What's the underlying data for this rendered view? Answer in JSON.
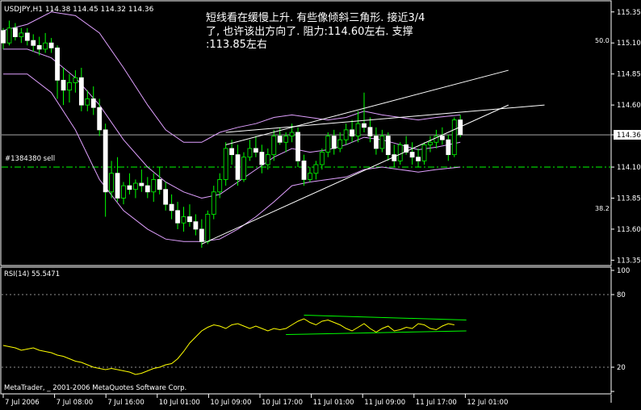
{
  "window": {
    "header": "USDJPY,H1  114.38 114.45 114.32 114.36",
    "annotation_lines": [
      "短线看在缓慢上升. 有些像倾斜三角形. 接近3/4",
      "了, 也许该出方向了. 阻力:114.60左右. 支撑",
      ":113.85左右"
    ],
    "order_label": "#1384380 sell",
    "rsi_label": "RSI(14) 55.5471",
    "copyright": "MetaTrader, _ 2001-2006 MetaQuotes Software Corp.",
    "current_price_tag": "114.36"
  },
  "colors": {
    "background": "#000000",
    "candle_up_body": "#000000",
    "candle_down_body": "#ffffff",
    "candle_wick": "#00ff00",
    "bollinger": "#e0a0ff",
    "trendline": "#ffffff",
    "order_line": "#00ff00",
    "rsi_line": "#ffff00",
    "rsi_trendline": "#00ff00",
    "axis_text": "#ffffff"
  },
  "chart_data": [
    {
      "type": "candlestick",
      "title": "USDJPY,H1",
      "y_ticks": [
        "115.35",
        "115.10",
        "114.85",
        "114.60",
        "114.36",
        "114.10",
        "113.85",
        "113.60",
        "113.35"
      ],
      "y_tick_values": [
        115.35,
        115.1,
        114.85,
        114.6,
        114.36,
        114.1,
        113.85,
        113.6,
        113.35
      ],
      "ylim": [
        113.32,
        115.42
      ],
      "side_labels": [
        {
          "text": "50.0",
          "value": 115.12
        },
        {
          "text": "38.2",
          "value": 113.77
        }
      ],
      "last_price": 114.36,
      "order_line_price": 114.1,
      "ohlc": [
        [
          115.2,
          115.22,
          115.05,
          115.1
        ],
        [
          115.1,
          115.28,
          115.08,
          115.22
        ],
        [
          115.22,
          115.26,
          115.12,
          115.15
        ],
        [
          115.15,
          115.22,
          115.1,
          115.18
        ],
        [
          115.18,
          115.22,
          115.08,
          115.12
        ],
        [
          115.12,
          115.17,
          115.03,
          115.08
        ],
        [
          115.08,
          115.15,
          115.0,
          115.05
        ],
        [
          115.05,
          115.18,
          115.02,
          115.1
        ],
        [
          115.1,
          115.14,
          115.02,
          115.06
        ],
        [
          115.06,
          115.08,
          114.65,
          114.8
        ],
        [
          114.8,
          114.9,
          114.6,
          114.72
        ],
        [
          114.72,
          114.85,
          114.62,
          114.78
        ],
        [
          114.78,
          114.88,
          114.7,
          114.82
        ],
        [
          114.82,
          114.9,
          114.55,
          114.6
        ],
        [
          114.6,
          114.72,
          114.55,
          114.65
        ],
        [
          114.65,
          114.75,
          114.52,
          114.58
        ],
        [
          114.58,
          114.65,
          114.35,
          114.4
        ],
        [
          114.4,
          114.45,
          113.7,
          113.9
        ],
        [
          113.9,
          114.15,
          113.85,
          114.05
        ],
        [
          114.05,
          114.18,
          113.82,
          113.85
        ],
        [
          113.85,
          113.98,
          113.8,
          113.95
        ],
        [
          113.95,
          114.05,
          113.88,
          113.92
        ],
        [
          113.92,
          114.0,
          113.85,
          113.97
        ],
        [
          113.97,
          114.08,
          113.9,
          113.95
        ],
        [
          113.95,
          114.02,
          113.85,
          113.9
        ],
        [
          113.9,
          114.05,
          113.82,
          114.0
        ],
        [
          114.0,
          114.1,
          113.88,
          113.92
        ],
        [
          113.92,
          113.98,
          113.75,
          113.8
        ],
        [
          113.8,
          113.88,
          113.68,
          113.75
        ],
        [
          113.75,
          113.82,
          113.6,
          113.65
        ],
        [
          113.65,
          113.78,
          113.58,
          113.7
        ],
        [
          113.7,
          113.8,
          113.62,
          113.66
        ],
        [
          113.66,
          113.72,
          113.55,
          113.6
        ],
        [
          113.6,
          113.68,
          113.45,
          113.5
        ],
        [
          113.5,
          113.75,
          113.48,
          113.72
        ],
        [
          113.72,
          113.95,
          113.68,
          113.9
        ],
        [
          113.9,
          114.05,
          113.85,
          114.0
        ],
        [
          114.0,
          114.3,
          113.95,
          114.25
        ],
        [
          114.25,
          114.32,
          114.12,
          114.2
        ],
        [
          114.2,
          114.28,
          113.95,
          114.0
        ],
        [
          114.0,
          114.22,
          113.98,
          114.18
        ],
        [
          114.18,
          114.32,
          114.15,
          114.25
        ],
        [
          114.25,
          114.35,
          114.18,
          114.22
        ],
        [
          114.22,
          114.28,
          114.05,
          114.12
        ],
        [
          114.12,
          114.25,
          114.08,
          114.2
        ],
        [
          114.2,
          114.4,
          114.15,
          114.35
        ],
        [
          114.35,
          114.42,
          114.28,
          114.3
        ],
        [
          114.3,
          114.38,
          114.22,
          114.35
        ],
        [
          114.35,
          114.45,
          114.3,
          114.38
        ],
        [
          114.38,
          114.42,
          114.1,
          114.15
        ],
        [
          114.15,
          114.2,
          113.95,
          114.0
        ],
        [
          114.0,
          114.1,
          113.98,
          114.05
        ],
        [
          114.05,
          114.15,
          114.0,
          114.12
        ],
        [
          114.12,
          114.25,
          114.08,
          114.22
        ],
        [
          114.22,
          114.38,
          114.18,
          114.35
        ],
        [
          114.35,
          114.4,
          114.2,
          114.25
        ],
        [
          114.25,
          114.38,
          114.22,
          114.32
        ],
        [
          114.32,
          114.45,
          114.28,
          114.4
        ],
        [
          114.4,
          114.48,
          114.3,
          114.35
        ],
        [
          114.35,
          114.55,
          114.3,
          114.45
        ],
        [
          114.45,
          114.7,
          114.38,
          114.42
        ],
        [
          114.42,
          114.5,
          114.3,
          114.35
        ],
        [
          114.35,
          114.42,
          114.2,
          114.25
        ],
        [
          114.25,
          114.4,
          114.22,
          114.35
        ],
        [
          114.35,
          114.38,
          114.15,
          114.2
        ],
        [
          114.2,
          114.28,
          114.1,
          114.15
        ],
        [
          114.15,
          114.3,
          114.12,
          114.28
        ],
        [
          114.28,
          114.35,
          114.2,
          114.22
        ],
        [
          114.22,
          114.3,
          114.12,
          114.18
        ],
        [
          114.18,
          114.25,
          114.1,
          114.15
        ],
        [
          114.15,
          114.3,
          114.12,
          114.28
        ],
        [
          114.28,
          114.35,
          114.22,
          114.3
        ],
        [
          114.3,
          114.4,
          114.25,
          114.35
        ],
        [
          114.35,
          114.42,
          114.28,
          114.32
        ],
        [
          114.32,
          114.36,
          114.15,
          114.2
        ],
        [
          114.2,
          114.5,
          114.18,
          114.48
        ],
        [
          114.48,
          114.52,
          114.34,
          114.36
        ]
      ],
      "bollinger_upper": [
        [
          0,
          115.2
        ],
        [
          4,
          115.25
        ],
        [
          8,
          115.35
        ],
        [
          12,
          115.32
        ],
        [
          16,
          115.18
        ],
        [
          20,
          114.9
        ],
        [
          24,
          114.6
        ],
        [
          27,
          114.4
        ],
        [
          30,
          114.3
        ],
        [
          33,
          114.3
        ],
        [
          36,
          114.38
        ],
        [
          39,
          114.42
        ],
        [
          42,
          114.45
        ],
        [
          45,
          114.5
        ],
        [
          48,
          114.52
        ],
        [
          51,
          114.5
        ],
        [
          54,
          114.48
        ],
        [
          57,
          114.5
        ],
        [
          60,
          114.55
        ],
        [
          63,
          114.52
        ],
        [
          66,
          114.5
        ],
        [
          69,
          114.48
        ],
        [
          72,
          114.5
        ],
        [
          76,
          114.52
        ]
      ],
      "bollinger_mid": [
        [
          0,
          115.05
        ],
        [
          4,
          115.05
        ],
        [
          8,
          114.98
        ],
        [
          12,
          114.82
        ],
        [
          16,
          114.6
        ],
        [
          20,
          114.32
        ],
        [
          24,
          114.1
        ],
        [
          27,
          113.98
        ],
        [
          30,
          113.9
        ],
        [
          33,
          113.85
        ],
        [
          36,
          113.88
        ],
        [
          39,
          113.98
        ],
        [
          42,
          114.08
        ],
        [
          45,
          114.18
        ],
        [
          48,
          114.25
        ],
        [
          51,
          114.22
        ],
        [
          54,
          114.24
        ],
        [
          57,
          114.28
        ],
        [
          60,
          114.34
        ],
        [
          63,
          114.32
        ],
        [
          66,
          114.28
        ],
        [
          69,
          114.24
        ],
        [
          72,
          114.26
        ],
        [
          76,
          114.3
        ]
      ],
      "bollinger_lower": [
        [
          0,
          114.85
        ],
        [
          4,
          114.85
        ],
        [
          8,
          114.7
        ],
        [
          12,
          114.4
        ],
        [
          16,
          114.0
        ],
        [
          20,
          113.75
        ],
        [
          24,
          113.6
        ],
        [
          27,
          113.52
        ],
        [
          30,
          113.5
        ],
        [
          33,
          113.5
        ],
        [
          36,
          113.52
        ],
        [
          39,
          113.6
        ],
        [
          42,
          113.7
        ],
        [
          45,
          113.82
        ],
        [
          48,
          113.95
        ],
        [
          51,
          113.98
        ],
        [
          54,
          114.0
        ],
        [
          57,
          114.02
        ],
        [
          60,
          114.08
        ],
        [
          63,
          114.1
        ],
        [
          66,
          114.08
        ],
        [
          69,
          114.06
        ],
        [
          72,
          114.08
        ],
        [
          76,
          114.1
        ]
      ],
      "trendlines": [
        {
          "from": [
            33,
            113.48
          ],
          "to": [
            84,
            114.6
          ]
        },
        {
          "from": [
            37,
            114.28
          ],
          "to": [
            84,
            114.88
          ]
        },
        {
          "from": [
            37,
            114.38
          ],
          "to": [
            90,
            114.6
          ]
        }
      ],
      "x_labels": [
        "7 Jul 2006",
        "7 Jul 08:00",
        "7 Jul 16:00",
        "10 Jul 01:00",
        "10 Jul 09:00",
        "10 Jul 17:00",
        "11 Jul 01:00",
        "11 Jul 09:00",
        "11 Jul 17:00",
        "12 Jul 01:00"
      ]
    },
    {
      "type": "line",
      "title": "RSI(14)",
      "ylim": [
        0,
        100
      ],
      "y_ticks": [
        "100",
        "80",
        "20",
        "0"
      ],
      "y_tick_values": [
        100,
        80,
        20,
        0
      ],
      "guide_levels": [
        80,
        20
      ],
      "values": [
        38,
        37,
        36,
        34,
        35,
        36,
        34,
        33,
        32,
        30,
        29,
        27,
        25,
        24,
        22,
        20,
        19,
        18,
        19,
        18,
        17,
        16,
        14,
        15,
        17,
        19,
        20,
        22,
        23,
        27,
        33,
        40,
        45,
        50,
        53,
        55,
        54,
        52,
        55,
        56,
        54,
        52,
        54,
        52,
        50,
        52,
        51,
        52,
        55,
        58,
        60,
        57,
        55,
        58,
        59,
        57,
        55,
        52,
        50,
        53,
        56,
        52,
        49,
        52,
        54,
        50,
        51,
        53,
        52,
        56,
        55,
        52,
        51,
        54,
        56,
        55
      ],
      "trendlines": [
        {
          "from": [
            50,
            63
          ],
          "to": [
            77,
            59
          ]
        },
        {
          "from": [
            47,
            47
          ],
          "to": [
            77,
            50
          ]
        }
      ]
    }
  ]
}
